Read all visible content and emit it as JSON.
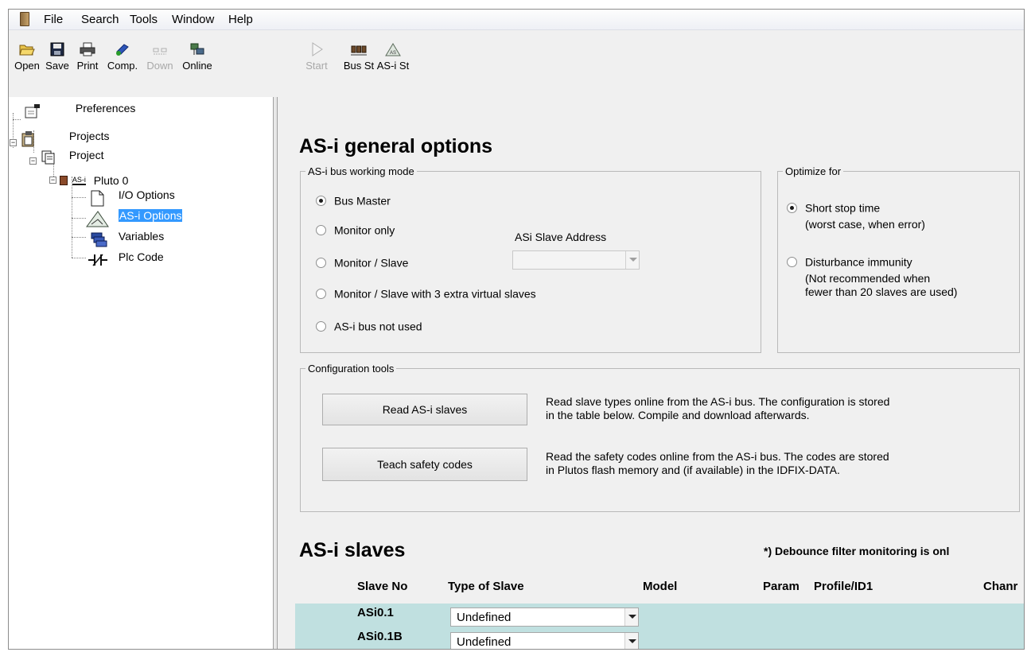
{
  "menu": {
    "items": [
      "File",
      "Search",
      "Tools",
      "Window",
      "Help"
    ]
  },
  "toolbar": {
    "open": "Open",
    "save": "Save",
    "print": "Print",
    "comp": "Comp.",
    "down": "Down",
    "online": "Online",
    "start": "Start",
    "bus_st": "Bus St",
    "asi_st": "AS-i St"
  },
  "tree": {
    "preferences": "Preferences",
    "projects": "Projects",
    "project": "Project",
    "pluto_badge": "AS-i",
    "pluto": "Pluto 0",
    "io_options": "I/O Options",
    "asi_options": "AS-i Options",
    "variables": "Variables",
    "plc_code": "Plc Code"
  },
  "main": {
    "title": "AS-i general options",
    "bus_mode": {
      "legend": "AS-i bus working mode",
      "options": [
        "Bus Master",
        "Monitor only",
        "Monitor / Slave",
        "Monitor / Slave with 3 extra virtual slaves",
        "AS-i bus not used"
      ],
      "selected": 0,
      "slave_address_label": "ASi Slave Address",
      "slave_address_value": ""
    },
    "optimize": {
      "legend": "Optimize for",
      "option1": "Short stop time",
      "option1_note": "(worst case, when error)",
      "option2": "Disturbance immunity",
      "option2_note1": "(Not recommended when",
      "option2_note2": "fewer than 20 slaves are used)",
      "selected": 0
    },
    "config": {
      "legend": "Configuration tools",
      "read_button": "Read AS-i slaves",
      "read_desc1": "Read slave types online from the AS-i bus. The configuration is stored",
      "read_desc2": "in the table below. Compile and download afterwards.",
      "teach_button": "Teach safety codes",
      "teach_desc1": "Read the safety codes online from the AS-i bus. The codes are stored",
      "teach_desc2": "in Plutos flash memory and (if available) in the IDFIX-DATA."
    },
    "slaves": {
      "title": "AS-i slaves",
      "note": "*) Debounce filter monitoring is onl",
      "columns": [
        "Slave No",
        "Type of Slave",
        "Model",
        "Param",
        "Profile/ID1",
        "Chanr"
      ],
      "rows": [
        {
          "slave_no": "ASi0.1",
          "type": "Undefined"
        },
        {
          "slave_no": "ASi0.1B",
          "type": "Undefined"
        }
      ]
    }
  }
}
